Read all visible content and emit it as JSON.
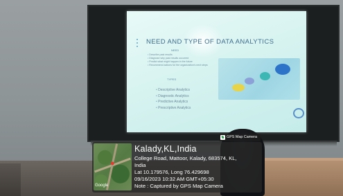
{
  "slide": {
    "title": "NEED AND TYPE OF DATA ANALYTICS",
    "need_heading": "NEED",
    "need_items": [
      "Describe past results",
      "Diagnose why past results occurred",
      "Predict what might happen in the future",
      "Recommend actions for the organization's next steps"
    ],
    "types_heading": "TYPES",
    "types_items": [
      "Descriptive Analytics",
      "Diagnostic Analytics",
      "Predictive Analytics",
      "Prescriptive Analytics"
    ]
  },
  "watermark": {
    "stamp": "GPS Map Camera",
    "map_label": "Google",
    "location_title": "Kalady,KL,India",
    "address_line1": "College Road, Mattoor, Kalady, 683574, KL,",
    "address_line2": "India",
    "coords": "Lat 10.179576, Long 76.429698",
    "datetime": "09/16/2023 10:32 AM GMT+05:30",
    "note": "Note : Captured by GPS Map Camera"
  },
  "colors": {
    "slide_bg": "#d8f3f0",
    "title_color": "#3f6e8f",
    "overlay_bg": "#282828"
  }
}
